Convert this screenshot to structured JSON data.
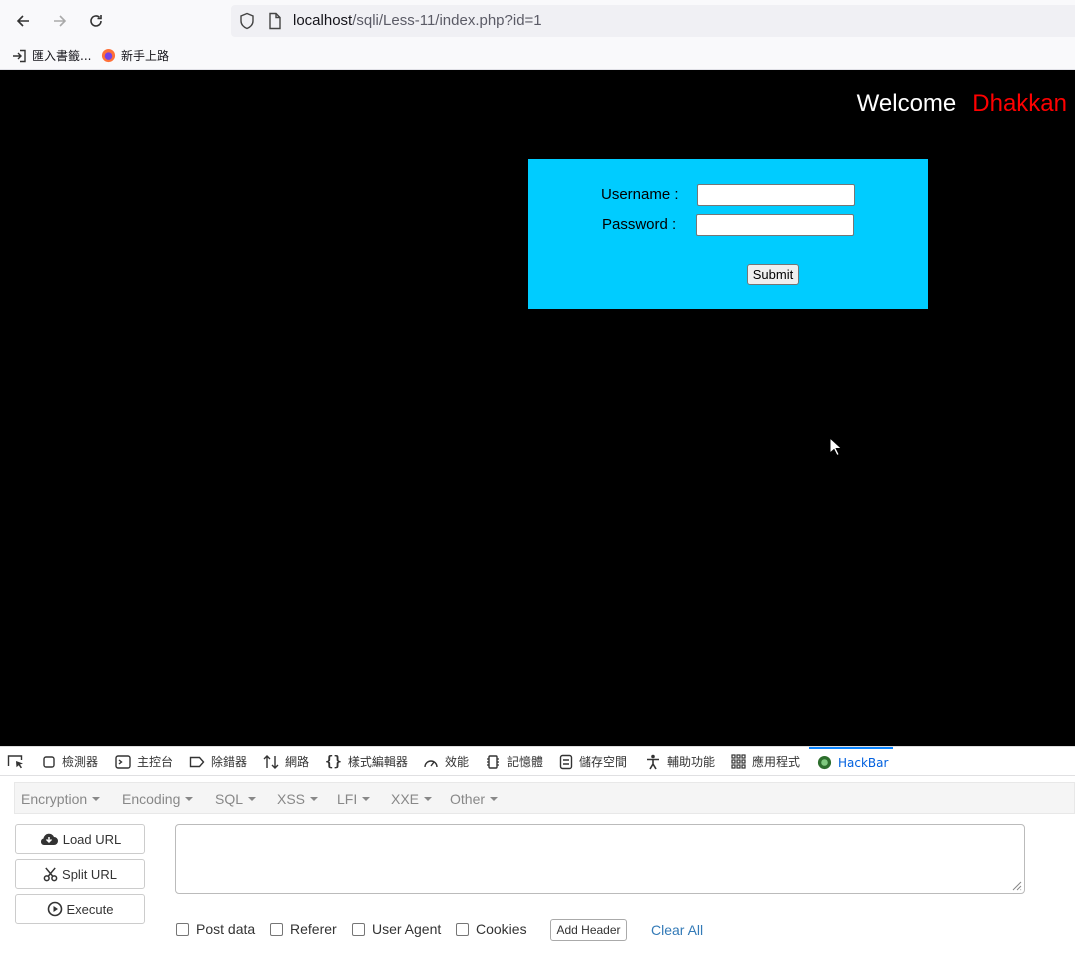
{
  "browser": {
    "url_host": "localhost",
    "url_path": "/sqli/Less-11/index.php?id=1",
    "bookmarks": [
      {
        "label": "匯入書籤..."
      },
      {
        "label": "新手上路"
      }
    ]
  },
  "page": {
    "welcome": "Welcome",
    "name": "Dhakkan",
    "username_label": "Username :",
    "password_label": "Password :",
    "submit_label": "Submit",
    "bg_color": "#000000",
    "box_color": "#00ccff",
    "name_color": "#ff0000"
  },
  "devtools": {
    "tabs": [
      "檢測器",
      "主控台",
      "除錯器",
      "網路",
      "樣式編輯器",
      "效能",
      "記憶體",
      "儲存空間",
      "輔助功能",
      "應用程式",
      "HackBar"
    ],
    "active_tab": "HackBar"
  },
  "hackbar": {
    "menus": [
      "Encryption",
      "Encoding",
      "SQL",
      "XSS",
      "LFI",
      "XXE",
      "Other"
    ],
    "buttons": {
      "load_url": "Load URL",
      "split_url": "Split URL",
      "execute": "Execute"
    },
    "url_value": "",
    "checkboxes": [
      "Post data",
      "Referer",
      "User Agent",
      "Cookies"
    ],
    "add_header": "Add Header",
    "clear_all": "Clear All"
  }
}
